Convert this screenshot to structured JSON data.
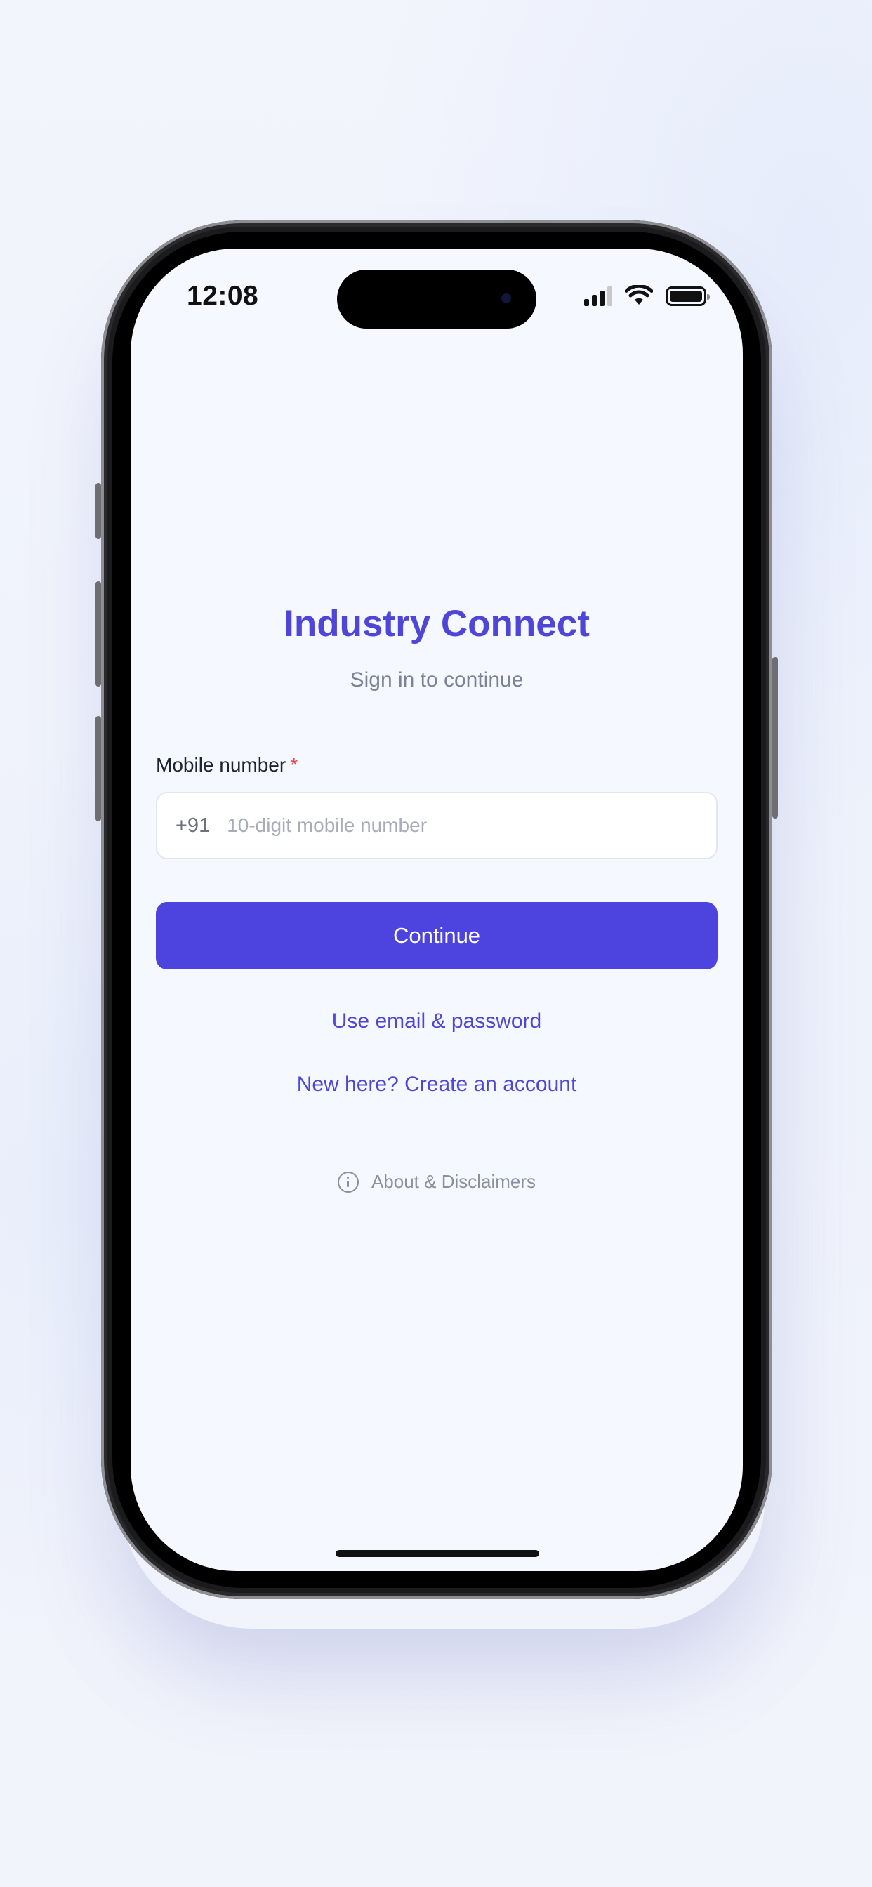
{
  "status_bar": {
    "time": "12:08"
  },
  "login": {
    "app_title": "Industry Connect",
    "subtitle": "Sign in to continue",
    "mobile_label": "Mobile number",
    "required_mark": "*",
    "country_code": "+91",
    "mobile_placeholder": "10-digit mobile number",
    "mobile_value": "",
    "continue_label": "Continue",
    "email_link": "Use email & password",
    "signup_link": "New here? Create an account",
    "about_link": "About & Disclaimers"
  },
  "colors": {
    "accent": "#4f45d6",
    "button": "#4d43df",
    "required": "#e5484d",
    "screen_background": "#f5f8fe"
  },
  "icons": {
    "signal": "cellular-signal-icon",
    "wifi": "wifi-icon",
    "battery": "battery-icon",
    "info": "info-circle-icon"
  }
}
